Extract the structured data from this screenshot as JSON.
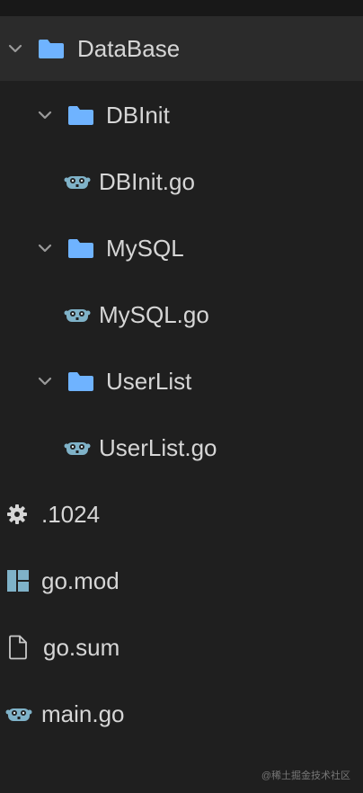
{
  "tree": {
    "root": {
      "label": "DataBase"
    },
    "dbinit_folder": {
      "label": "DBInit"
    },
    "dbinit_file": {
      "label": "DBInit.go"
    },
    "mysql_folder": {
      "label": "MySQL"
    },
    "mysql_file": {
      "label": "MySQL.go"
    },
    "userlist_folder": {
      "label": "UserList"
    },
    "userlist_file": {
      "label": "UserList.go"
    },
    "config_file": {
      "label": ".1024"
    },
    "gomod_file": {
      "label": "go.mod"
    },
    "gosum_file": {
      "label": "go.sum"
    },
    "main_file": {
      "label": "main.go"
    }
  },
  "watermark": "@稀土掘金技术社区",
  "colors": {
    "background": "#1f1f1f",
    "selected_row": "#2b2b2b",
    "folder_icon": "#6fb3ff",
    "go_icon": "#7fb2c8",
    "text": "#d6d6d6",
    "chevron": "#9a9a9a"
  },
  "icons": {
    "chevron": "chevron-down-icon",
    "folder": "folder-icon",
    "go_file": "go-gopher-icon",
    "settings": "gear-icon",
    "go_mod": "go-mod-icon",
    "plain_file": "file-icon"
  }
}
